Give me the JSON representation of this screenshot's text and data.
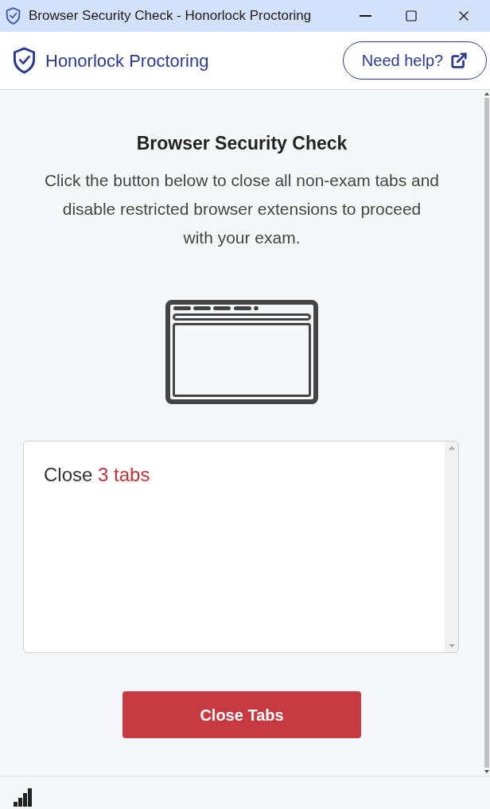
{
  "window": {
    "title": "Browser Security Check - Honorlock Proctoring"
  },
  "header": {
    "brand": "Honorlock Proctoring",
    "help_button": "Need help?"
  },
  "content": {
    "title": "Browser Security Check",
    "description": "Click the button below to close all non-exam tabs and disable restricted browser extensions to proceed with your exam.",
    "tab_list": {
      "prefix": "Close",
      "count": "3 tabs"
    },
    "action_button": "Close Tabs"
  }
}
